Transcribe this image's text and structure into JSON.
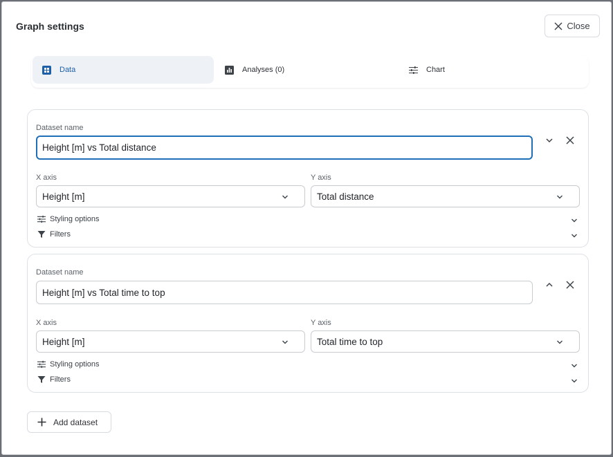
{
  "dialog": {
    "title": "Graph settings",
    "close_label": "Close"
  },
  "tabs": [
    {
      "label": "Data",
      "active": true,
      "icon": "grid-icon"
    },
    {
      "label": "Analyses (0)",
      "active": false,
      "icon": "bar-chart-icon"
    },
    {
      "label": "Chart",
      "active": false,
      "icon": "sliders-icon"
    }
  ],
  "datasets": [
    {
      "name_label": "Dataset name",
      "name_value": "Height [m] vs Total distance",
      "expanded": true,
      "x_label": "X axis",
      "x_value": "Height [m]",
      "y_label": "Y axis",
      "y_value": "Total distance",
      "styling_label": "Styling options",
      "filters_label": "Filters"
    },
    {
      "name_label": "Dataset name",
      "name_value": "Height [m] vs Total time to top",
      "expanded": false,
      "x_label": "X axis",
      "x_value": "Height [m]",
      "y_label": "Y axis",
      "y_value": "Total time to top",
      "styling_label": "Styling options",
      "filters_label": "Filters"
    }
  ],
  "add_dataset_label": "Add dataset",
  "colors": {
    "accent": "#1f6fb8",
    "active_tab_bg": "#eef2f7"
  }
}
